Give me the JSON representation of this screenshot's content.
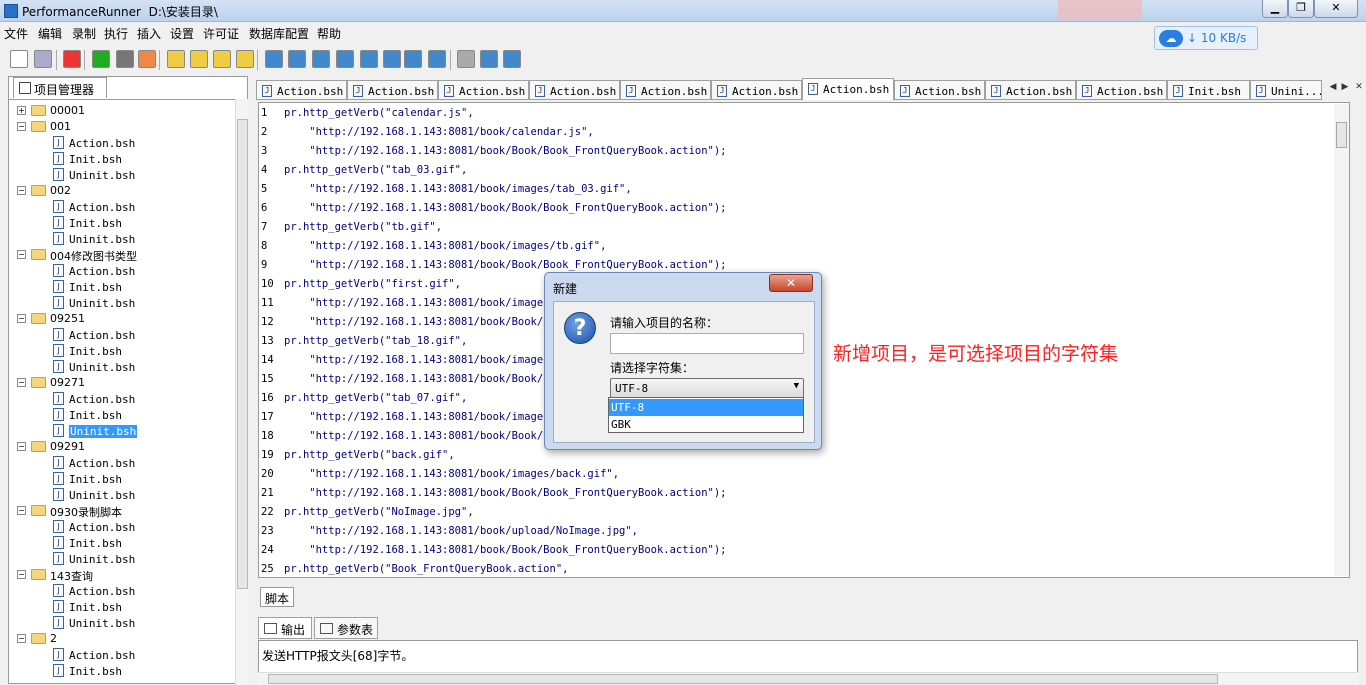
{
  "window": {
    "title": "PerformanceRunner  D:\\安装目录\\"
  },
  "menu": [
    "文件",
    "编辑",
    "录制",
    "执行",
    "插入",
    "设置",
    "许可证",
    "数据库配置",
    "帮助"
  ],
  "network": {
    "speed": "10 KB/s",
    "arrow": "↓"
  },
  "project_panel": {
    "tab_label": "项目管理器",
    "tree": [
      {
        "type": "folder",
        "label": "00001",
        "expanded": false
      },
      {
        "type": "folder",
        "label": "001",
        "expanded": true
      },
      {
        "type": "file",
        "label": "Action.bsh"
      },
      {
        "type": "file",
        "label": "Init.bsh"
      },
      {
        "type": "file",
        "label": "Uninit.bsh"
      },
      {
        "type": "folder",
        "label": "002",
        "expanded": true
      },
      {
        "type": "file",
        "label": "Action.bsh"
      },
      {
        "type": "file",
        "label": "Init.bsh"
      },
      {
        "type": "file",
        "label": "Uninit.bsh"
      },
      {
        "type": "folder",
        "label": "004修改图书类型",
        "expanded": true
      },
      {
        "type": "file",
        "label": "Action.bsh"
      },
      {
        "type": "file",
        "label": "Init.bsh"
      },
      {
        "type": "file",
        "label": "Uninit.bsh"
      },
      {
        "type": "folder",
        "label": "09251",
        "expanded": true
      },
      {
        "type": "file",
        "label": "Action.bsh"
      },
      {
        "type": "file",
        "label": "Init.bsh"
      },
      {
        "type": "file",
        "label": "Uninit.bsh"
      },
      {
        "type": "folder",
        "label": "09271",
        "expanded": true
      },
      {
        "type": "file",
        "label": "Action.bsh"
      },
      {
        "type": "file",
        "label": "Init.bsh"
      },
      {
        "type": "file",
        "label": "Uninit.bsh",
        "selected": true
      },
      {
        "type": "folder",
        "label": "09291",
        "expanded": true
      },
      {
        "type": "file",
        "label": "Action.bsh"
      },
      {
        "type": "file",
        "label": "Init.bsh"
      },
      {
        "type": "file",
        "label": "Uninit.bsh"
      },
      {
        "type": "folder",
        "label": "0930录制脚本",
        "expanded": true
      },
      {
        "type": "file",
        "label": "Action.bsh"
      },
      {
        "type": "file",
        "label": "Init.bsh"
      },
      {
        "type": "file",
        "label": "Uninit.bsh"
      },
      {
        "type": "folder",
        "label": "143查询",
        "expanded": true
      },
      {
        "type": "file",
        "label": "Action.bsh"
      },
      {
        "type": "file",
        "label": "Init.bsh"
      },
      {
        "type": "file",
        "label": "Uninit.bsh"
      },
      {
        "type": "folder",
        "label": "2",
        "expanded": true
      },
      {
        "type": "file",
        "label": "Action.bsh"
      },
      {
        "type": "file",
        "label": "Init.bsh"
      }
    ]
  },
  "editor_tabs": [
    "Action.bsh",
    "Action.bsh",
    "Action.bsh",
    "Action.bsh",
    "Action.bsh",
    "Action.bsh",
    "Action.bsh",
    "Action.bsh",
    "Action.bsh",
    "Action.bsh",
    "Init.bsh",
    "Unini..."
  ],
  "active_tab_index": 6,
  "code_lines": [
    "pr.http_getVerb(\"calendar.js\",",
    "    \"http://192.168.1.143:8081/book/calendar.js\",",
    "    \"http://192.168.1.143:8081/book/Book/Book_FrontQueryBook.action\");",
    "pr.http_getVerb(\"tab_03.gif\",",
    "    \"http://192.168.1.143:8081/book/images/tab_03.gif\",",
    "    \"http://192.168.1.143:8081/book/Book/Book_FrontQueryBook.action\");",
    "pr.http_getVerb(\"tb.gif\",",
    "    \"http://192.168.1.143:8081/book/images/tb.gif\",",
    "    \"http://192.168.1.143:8081/book/Book/Book_FrontQueryBook.action\");",
    "pr.http_getVerb(\"first.gif\",",
    "    \"http://192.168.1.143:8081/book/images/",
    "    \"http://192.168.1.143:8081/book/Book/Bo",
    "pr.http_getVerb(\"tab_18.gif\",",
    "    \"http://192.168.1.143:8081/book/images/",
    "    \"http://192.168.1.143:8081/book/Book/Bo",
    "pr.http_getVerb(\"tab_07.gif\",",
    "    \"http://192.168.1.143:8081/book/images/",
    "    \"http://192.168.1.143:8081/book/Book/Bo",
    "pr.http_getVerb(\"back.gif\",",
    "    \"http://192.168.1.143:8081/book/images/back.gif\",",
    "    \"http://192.168.1.143:8081/book/Book/Book_FrontQueryBook.action\");",
    "pr.http_getVerb(\"NoImage.jpg\",",
    "    \"http://192.168.1.143:8081/book/upload/NoImage.jpg\",",
    "    \"http://192.168.1.143:8081/book/Book/Book_FrontQueryBook.action\");",
    "pr.http_getVerb(\"Book_FrontQueryBook.action\","
  ],
  "script_tab": "脚本",
  "bottom_tabs": {
    "output": "输出",
    "params": "参数表"
  },
  "output_text": "发送HTTP报文头[68]字节。",
  "dialog": {
    "title": "新建",
    "close": "✕",
    "icon": "?",
    "name_label": "请输入项目的名称：",
    "name_value": "",
    "charset_label": "请选择字符集：",
    "charset_selected": "UTF-8",
    "charset_options": [
      "UTF-8",
      "GBK"
    ]
  },
  "annotation": "新增项目，是可选择项目的字符集",
  "icons": {
    "question": "question-icon",
    "folder": "folder-icon",
    "file": "java-file-icon"
  }
}
